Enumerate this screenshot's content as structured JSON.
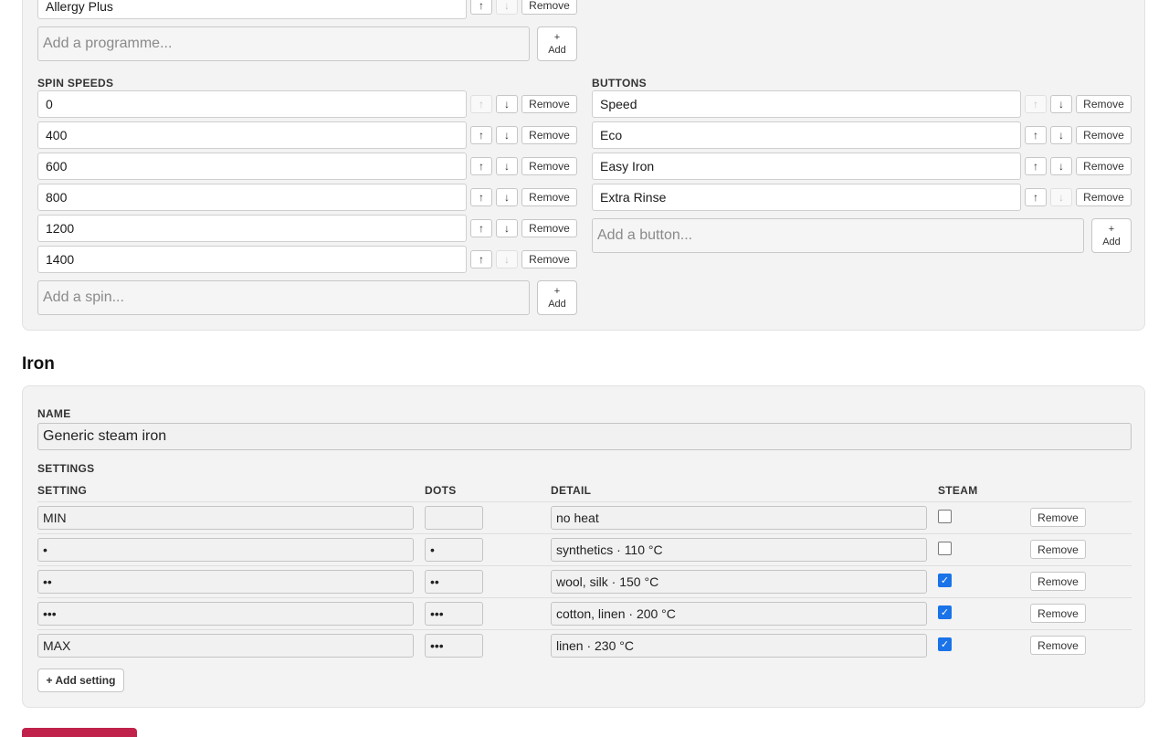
{
  "programmes": {
    "last_item": "Allergy Plus",
    "add_placeholder": "Add a programme...",
    "add_label_plus": "+",
    "add_label": "Add"
  },
  "common": {
    "remove_label": "Remove",
    "up_arrow": "↑",
    "down_arrow": "↓"
  },
  "spin_speeds": {
    "label": "SPIN SPEEDS",
    "items": [
      "0",
      "400",
      "600",
      "800",
      "1200",
      "1400"
    ],
    "add_placeholder": "Add a spin...",
    "add_label_plus": "+",
    "add_label": "Add"
  },
  "buttons": {
    "label": "BUTTONS",
    "items": [
      "Speed",
      "Eco",
      "Easy Iron",
      "Extra Rinse"
    ],
    "add_placeholder": "Add a button...",
    "add_label_plus": "+",
    "add_label": "Add"
  },
  "iron": {
    "heading": "Iron",
    "name_label": "NAME",
    "name_value": "Generic steam iron",
    "settings_label": "SETTINGS",
    "columns": {
      "setting": "SETTING",
      "dots": "DOTS",
      "detail": "DETAIL",
      "steam": "STEAM"
    },
    "rows": [
      {
        "setting": "MIN",
        "dots": "",
        "detail": "no heat",
        "steam": false
      },
      {
        "setting": "•",
        "dots": "•",
        "detail": "synthetics · 110 °C",
        "steam": false
      },
      {
        "setting": "••",
        "dots": "••",
        "detail": "wool, silk · 150 °C",
        "steam": true
      },
      {
        "setting": "•••",
        "dots": "•••",
        "detail": "cotton, linen · 200 °C",
        "steam": true
      },
      {
        "setting": "MAX",
        "dots": "•••",
        "detail": "linen · 230 °C",
        "steam": true
      }
    ],
    "add_setting_label": "+ Add setting"
  },
  "colors": {
    "accent": "#1a73e8",
    "danger": "#c0224b",
    "card_bg": "#f3f3f3"
  }
}
